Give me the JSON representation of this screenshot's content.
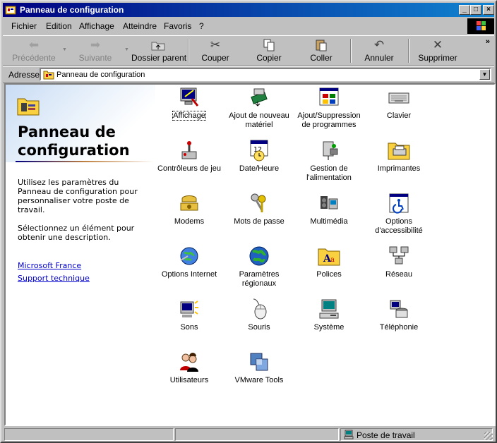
{
  "window": {
    "title": "Panneau de configuration"
  },
  "menubar": [
    "Fichier",
    "Edition",
    "Affichage",
    "Atteindre",
    "Favoris",
    "?"
  ],
  "toolbar": {
    "back": "Précédente",
    "forward": "Suivante",
    "up": "Dossier parent",
    "cut": "Couper",
    "copy": "Copier",
    "paste": "Coller",
    "undo": "Annuler",
    "delete": "Supprimer"
  },
  "address": {
    "label": "Adresse",
    "value": "Panneau de configuration"
  },
  "left_pane": {
    "title": "Panneau de configuration",
    "description": "Utilisez les paramètres du Panneau de configuration pour personnaliser votre poste de travail.",
    "hint": "Sélectionnez un élément pour obtenir une description.",
    "links": [
      "Microsoft France",
      "Support technique"
    ]
  },
  "icons": [
    {
      "label": "Affichage",
      "icon": "display-icon",
      "selected": true
    },
    {
      "label": "Ajout de nouveau matériel",
      "icon": "add-hardware-icon"
    },
    {
      "label": "Ajout/Suppression de programmes",
      "icon": "add-remove-programs-icon"
    },
    {
      "label": "Clavier",
      "icon": "keyboard-icon"
    },
    {
      "label": "Contrôleurs de jeu",
      "icon": "game-controller-icon"
    },
    {
      "label": "Date/Heure",
      "icon": "calendar-clock-icon"
    },
    {
      "label": "Gestion de l'alimentation",
      "icon": "power-icon"
    },
    {
      "label": "Imprimantes",
      "icon": "printer-folder-icon"
    },
    {
      "label": "Modems",
      "icon": "modem-phone-icon"
    },
    {
      "label": "Mots de passe",
      "icon": "keys-icon"
    },
    {
      "label": "Multimédia",
      "icon": "multimedia-icon"
    },
    {
      "label": "Options d'accessibilité",
      "icon": "accessibility-icon"
    },
    {
      "label": "Options Internet",
      "icon": "internet-globe-icon"
    },
    {
      "label": "Paramètres régionaux",
      "icon": "regional-globe-icon"
    },
    {
      "label": "Polices",
      "icon": "fonts-folder-icon"
    },
    {
      "label": "Réseau",
      "icon": "network-icon"
    },
    {
      "label": "Sons",
      "icon": "speaker-icon"
    },
    {
      "label": "Souris",
      "icon": "mouse-icon"
    },
    {
      "label": "Système",
      "icon": "computer-icon"
    },
    {
      "label": "Téléphonie",
      "icon": "telephony-icon"
    },
    {
      "label": "Utilisateurs",
      "icon": "users-icon"
    },
    {
      "label": "VMware Tools",
      "icon": "vmware-icon"
    }
  ],
  "statusbar": {
    "zone": "Poste de travail"
  }
}
